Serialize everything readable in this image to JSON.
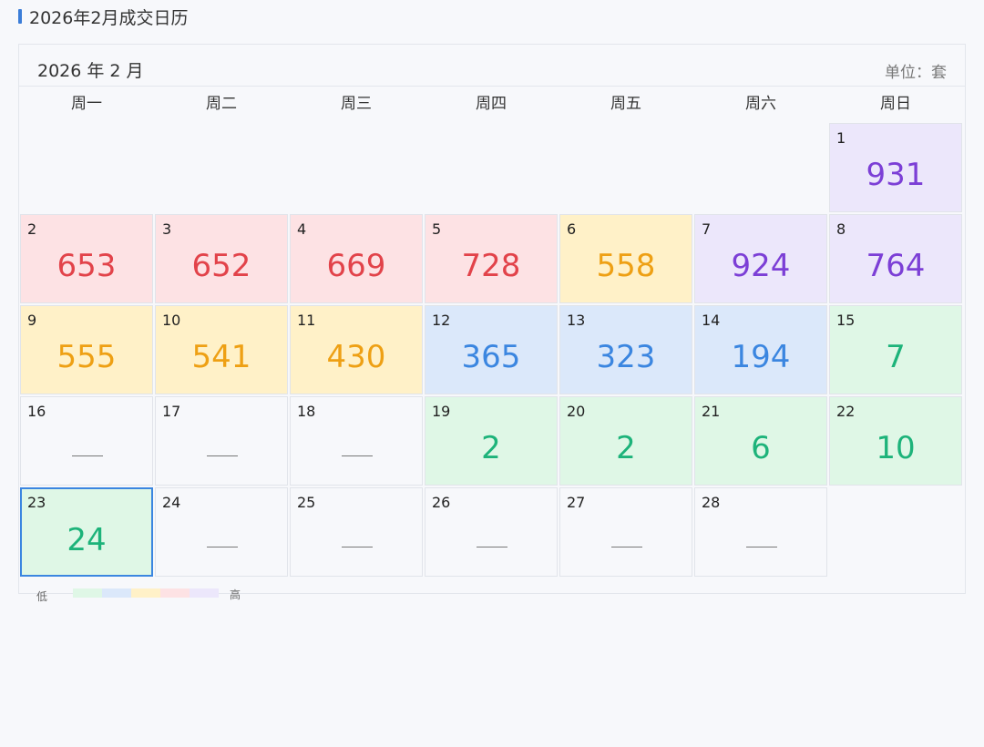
{
  "page": {
    "title": "2026年2月成交日历"
  },
  "calendar": {
    "month_label": "2026 年 2 月",
    "unit_label": "单位：套",
    "weekdays": [
      "周一",
      "周二",
      "周三",
      "周四",
      "周五",
      "周六",
      "周日"
    ],
    "first_weekday_index": 6,
    "selected_day": 23,
    "days": [
      {
        "day": "1",
        "value": "931",
        "level": 5
      },
      {
        "day": "2",
        "value": "653",
        "level": 4
      },
      {
        "day": "3",
        "value": "652",
        "level": 4
      },
      {
        "day": "4",
        "value": "669",
        "level": 4
      },
      {
        "day": "5",
        "value": "728",
        "level": 4
      },
      {
        "day": "6",
        "value": "558",
        "level": 3
      },
      {
        "day": "7",
        "value": "924",
        "level": 5
      },
      {
        "day": "8",
        "value": "764",
        "level": 5
      },
      {
        "day": "9",
        "value": "555",
        "level": 3
      },
      {
        "day": "10",
        "value": "541",
        "level": 3
      },
      {
        "day": "11",
        "value": "430",
        "level": 3
      },
      {
        "day": "12",
        "value": "365",
        "level": 2
      },
      {
        "day": "13",
        "value": "323",
        "level": 2
      },
      {
        "day": "14",
        "value": "194",
        "level": 2
      },
      {
        "day": "15",
        "value": "7",
        "level": 1
      },
      {
        "day": "16",
        "value": null,
        "level": 0
      },
      {
        "day": "17",
        "value": null,
        "level": 0
      },
      {
        "day": "18",
        "value": null,
        "level": 0
      },
      {
        "day": "19",
        "value": "2",
        "level": 1
      },
      {
        "day": "20",
        "value": "2",
        "level": 1
      },
      {
        "day": "21",
        "value": "6",
        "level": 1
      },
      {
        "day": "22",
        "value": "10",
        "level": 1
      },
      {
        "day": "23",
        "value": "24",
        "level": 1
      },
      {
        "day": "24",
        "value": null,
        "level": 0
      },
      {
        "day": "25",
        "value": null,
        "level": 0
      },
      {
        "day": "26",
        "value": null,
        "level": 0
      },
      {
        "day": "27",
        "value": null,
        "level": 0
      },
      {
        "day": "28",
        "value": null,
        "level": 0
      }
    ]
  },
  "legend": {
    "low_label": "低",
    "high_label": "高",
    "colors": [
      "#dff7e6",
      "#dbe8fa",
      "#fff1c8",
      "#fde2e4",
      "#ece7fb"
    ]
  }
}
